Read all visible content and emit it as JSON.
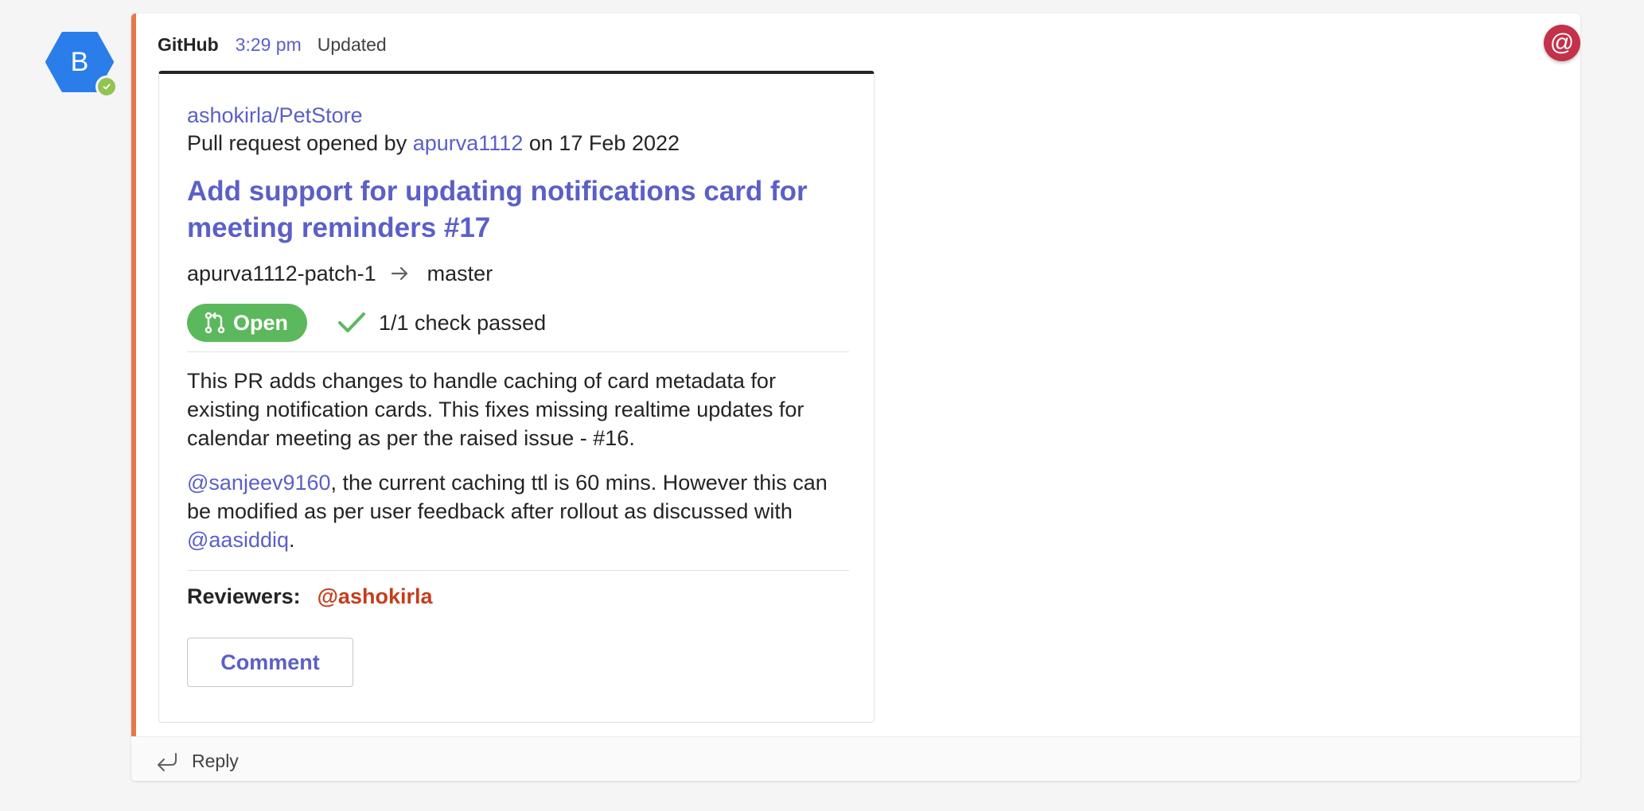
{
  "avatar": {
    "initial": "B",
    "color": "#2b7de9",
    "presence": "available"
  },
  "message": {
    "sender": "GitHub",
    "time": "3:29 pm",
    "status": "Updated",
    "accent_color": "#e97548",
    "mention_icon": "@"
  },
  "card": {
    "repo": "ashokirla/PetStore",
    "opened_prefix": "Pull request opened by",
    "opened_by": "apurva1112",
    "opened_suffix": "on 17 Feb 2022",
    "title": "Add support for updating notifications card for meeting reminders #17",
    "source_branch": "apurva1112-patch-1",
    "target_branch": "master",
    "state": "Open",
    "checks": "1/1 check passed",
    "description": "This PR adds changes to handle caching of card metadata for existing notification cards. This fixes missing realtime updates for calendar meeting as per the raised issue - #16.",
    "note_mention": "@sanjeev9160",
    "note_text": ", the current caching ttl is 60 mins. However this can be modified as per user feedback after rollout as discussed with",
    "note_mention2": "@aasiddiq",
    "note_end": ".",
    "reviewers_label": "Reviewers:",
    "reviewer": "@ashokirla",
    "comment_label": "Comment"
  },
  "reply": {
    "label": "Reply"
  }
}
